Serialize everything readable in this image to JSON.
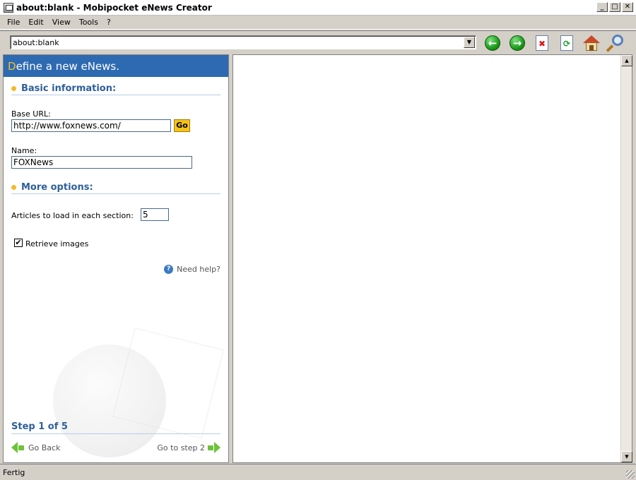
{
  "window": {
    "title": "about:blank - Mobipocket eNews Creator",
    "minimize": "_",
    "maximize": "□",
    "close": "✕"
  },
  "menu": {
    "items": [
      "File",
      "Edit",
      "View",
      "Tools",
      "?"
    ]
  },
  "toolbar": {
    "address_value": "about:blank",
    "buttons": [
      "back-icon",
      "forward-icon",
      "stop-icon",
      "refresh-icon",
      "home-icon",
      "search-icon"
    ]
  },
  "panel": {
    "header_first": "D",
    "header_rest": "efine a new eNews.",
    "basic": {
      "title": "Basic information:",
      "base_url_label": "Base URL:",
      "base_url_value": "http://www.foxnews.com/",
      "go_label": "Go",
      "name_label": "Name:",
      "name_value": "FOXNews"
    },
    "more": {
      "title": "More options:",
      "articles_label": "Articles to load in each section:",
      "articles_value": "5",
      "retrieve_images_label": "Retrieve images",
      "retrieve_images_checked": true
    },
    "help_label": "Need help?",
    "step_label": "Step 1 of 5",
    "go_back_label": "Go Back",
    "go_next_label": "Go to step 2"
  },
  "status": {
    "text": "Fertig"
  },
  "colors": {
    "header_bg": "#2e6ab1",
    "header_accent": "#f5c02a",
    "section_title": "#2e5f9a",
    "go_button": "#f5c419",
    "nav_arrow": "#6cc23a"
  }
}
